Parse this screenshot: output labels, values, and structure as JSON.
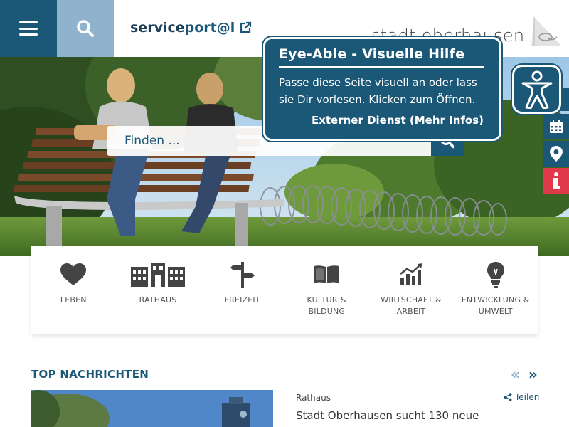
{
  "header": {
    "serviceportal_a": "service",
    "serviceportal_b": "port@l",
    "logo_text": "stadt oberhausen"
  },
  "search": {
    "placeholder": "Finden ..."
  },
  "tooltip": {
    "title": "Eye-Able - Visuelle Hilfe",
    "body": "Passe diese Seite visuell an oder lass sie Dir vorlesen. Klicken zum Öffnen.",
    "ext_prefix": "Externer Dienst (",
    "ext_link": "Mehr Infos",
    "ext_suffix": ")"
  },
  "categories": [
    {
      "label": "LEBEN",
      "icon": "heart-icon"
    },
    {
      "label": "RATHAUS",
      "icon": "town-hall-icon"
    },
    {
      "label": "FREIZEIT",
      "icon": "signpost-icon"
    },
    {
      "label": "KULTUR &\nBILDUNG",
      "icon": "book-icon"
    },
    {
      "label": "WIRTSCHAFT &\nARBEIT",
      "icon": "chart-icon"
    },
    {
      "label": "ENTWICKLUNG &\nUMWELT",
      "icon": "lightbulb-icon"
    }
  ],
  "news": {
    "title": "TOP NACHRICHTEN",
    "prev": "«",
    "next": "»",
    "category": "Rathaus",
    "share": "Teilen",
    "headline": "Stadt Oberhausen sucht 130 neue"
  },
  "colors": {
    "primary": "#1b5777",
    "light": "#8fb3cc",
    "info": "#e0394a"
  }
}
